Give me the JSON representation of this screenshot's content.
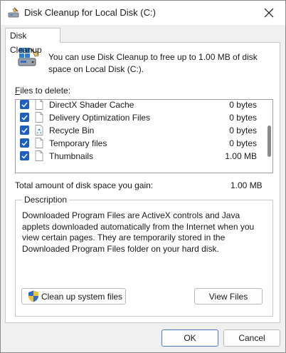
{
  "window": {
    "title": "Disk Cleanup for Local Disk  (C:)"
  },
  "tab": {
    "label": "Disk Cleanup"
  },
  "info": {
    "text": "You can use Disk Cleanup to free up to 1.00 MB of disk space on Local Disk (C:)."
  },
  "files_label": {
    "prefix": "F",
    "rest": "iles to delete:"
  },
  "files": [
    {
      "name": "DirectX Shader Cache",
      "size": "0 bytes",
      "checked": true,
      "icon": "file-icon"
    },
    {
      "name": "Delivery Optimization Files",
      "size": "0 bytes",
      "checked": true,
      "icon": "file-icon"
    },
    {
      "name": "Recycle Bin",
      "size": "0 bytes",
      "checked": true,
      "icon": "recycle-bin-icon"
    },
    {
      "name": "Temporary files",
      "size": "0 bytes",
      "checked": true,
      "icon": "file-icon"
    },
    {
      "name": "Thumbnails",
      "size": "1.00 MB",
      "checked": true,
      "icon": "file-icon"
    }
  ],
  "total": {
    "label": "Total amount of disk space you gain:",
    "value": "1.00 MB"
  },
  "description": {
    "legend": "Description",
    "text": "Downloaded Program Files are ActiveX controls and Java applets downloaded automatically from the Internet when you view certain pages. They are temporarily stored in the Downloaded Program Files folder on your hard disk."
  },
  "buttons": {
    "cleanup_system": "Clean up system files",
    "view_files": "View Files",
    "ok": "OK",
    "cancel": "Cancel"
  },
  "colors": {
    "checkbox": "#1f5fbf",
    "accent_border": "#4a7cc4"
  }
}
